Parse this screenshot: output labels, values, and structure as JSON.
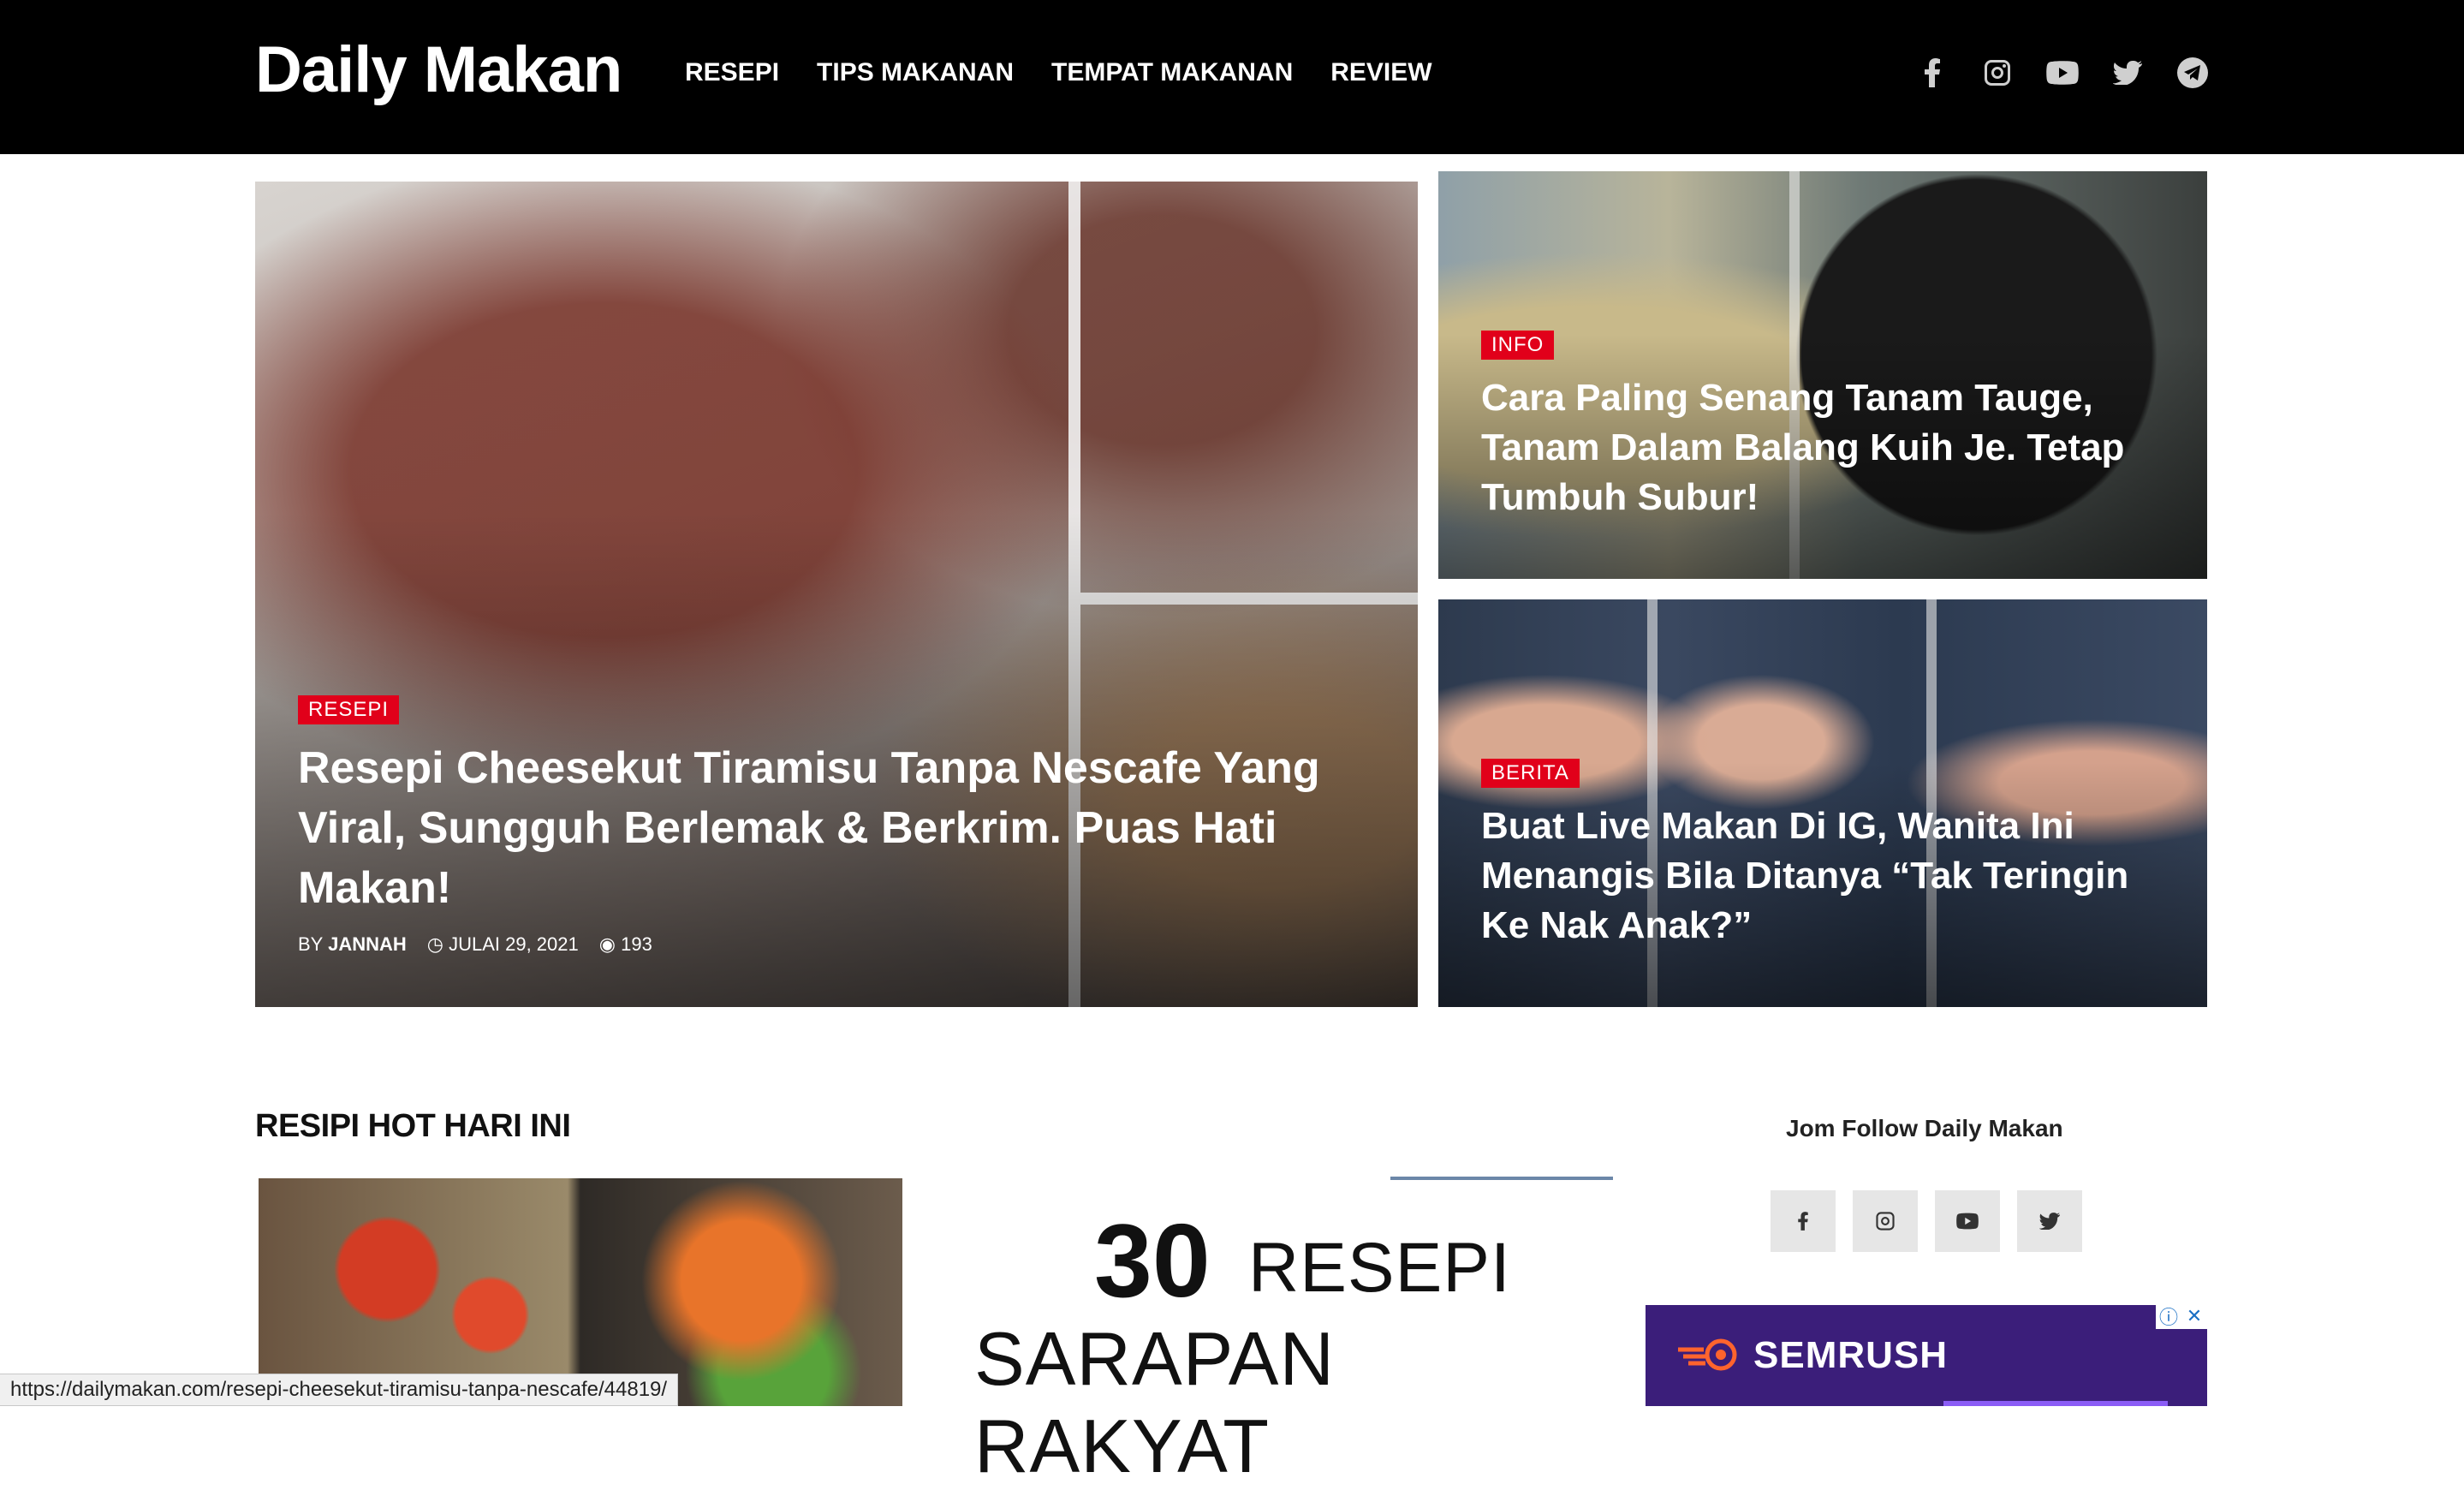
{
  "site": {
    "logo": "Daily Makan"
  },
  "nav": {
    "items": [
      "RESEPI",
      "TIPS MAKANAN",
      "TEMPAT MAKANAN",
      "REVIEW"
    ]
  },
  "social_top": [
    "facebook-icon",
    "instagram-icon",
    "youtube-icon",
    "twitter-icon",
    "telegram-icon"
  ],
  "featured": {
    "main": {
      "tag": "RESEPI",
      "title": "Resepi Cheesekut Tiramisu Tanpa Nescafe Yang Viral, Sungguh Berlemak & Berkrim. Puas Hati Makan!",
      "by_label": "BY",
      "author": "JANNAH",
      "date": "JULAI 29, 2021",
      "views": "193"
    },
    "side": [
      {
        "tag": "INFO",
        "title": "Cara Paling Senang Tanam Tauge, Tanam Dalam Balang Kuih Je. Tetap Tumbuh Subur!"
      },
      {
        "tag": "BERITA",
        "title": "Buat Live Makan Di IG, Wanita Ini Menangis Bila Ditanya “Tak Teringin Ke Nak Anak?”"
      }
    ]
  },
  "section": {
    "title": "RESIPI HOT HARI INI"
  },
  "promo": {
    "number": "30",
    "word": "RESEPI",
    "line2": "SARAPAN RAKYAT"
  },
  "follow": {
    "title": "Jom Follow Daily Makan",
    "icons": [
      "facebook-icon",
      "instagram-icon",
      "youtube-icon",
      "twitter-icon"
    ]
  },
  "ad": {
    "brand": "SEMRUSH"
  },
  "status_bar": {
    "url": "https://dailymakan.com/resepi-cheesekut-tiramisu-tanpa-nescafe/44819/"
  },
  "colors": {
    "accent": "#e1001a",
    "header_bg": "#000000",
    "ad_bg": "#3b1e7a"
  }
}
